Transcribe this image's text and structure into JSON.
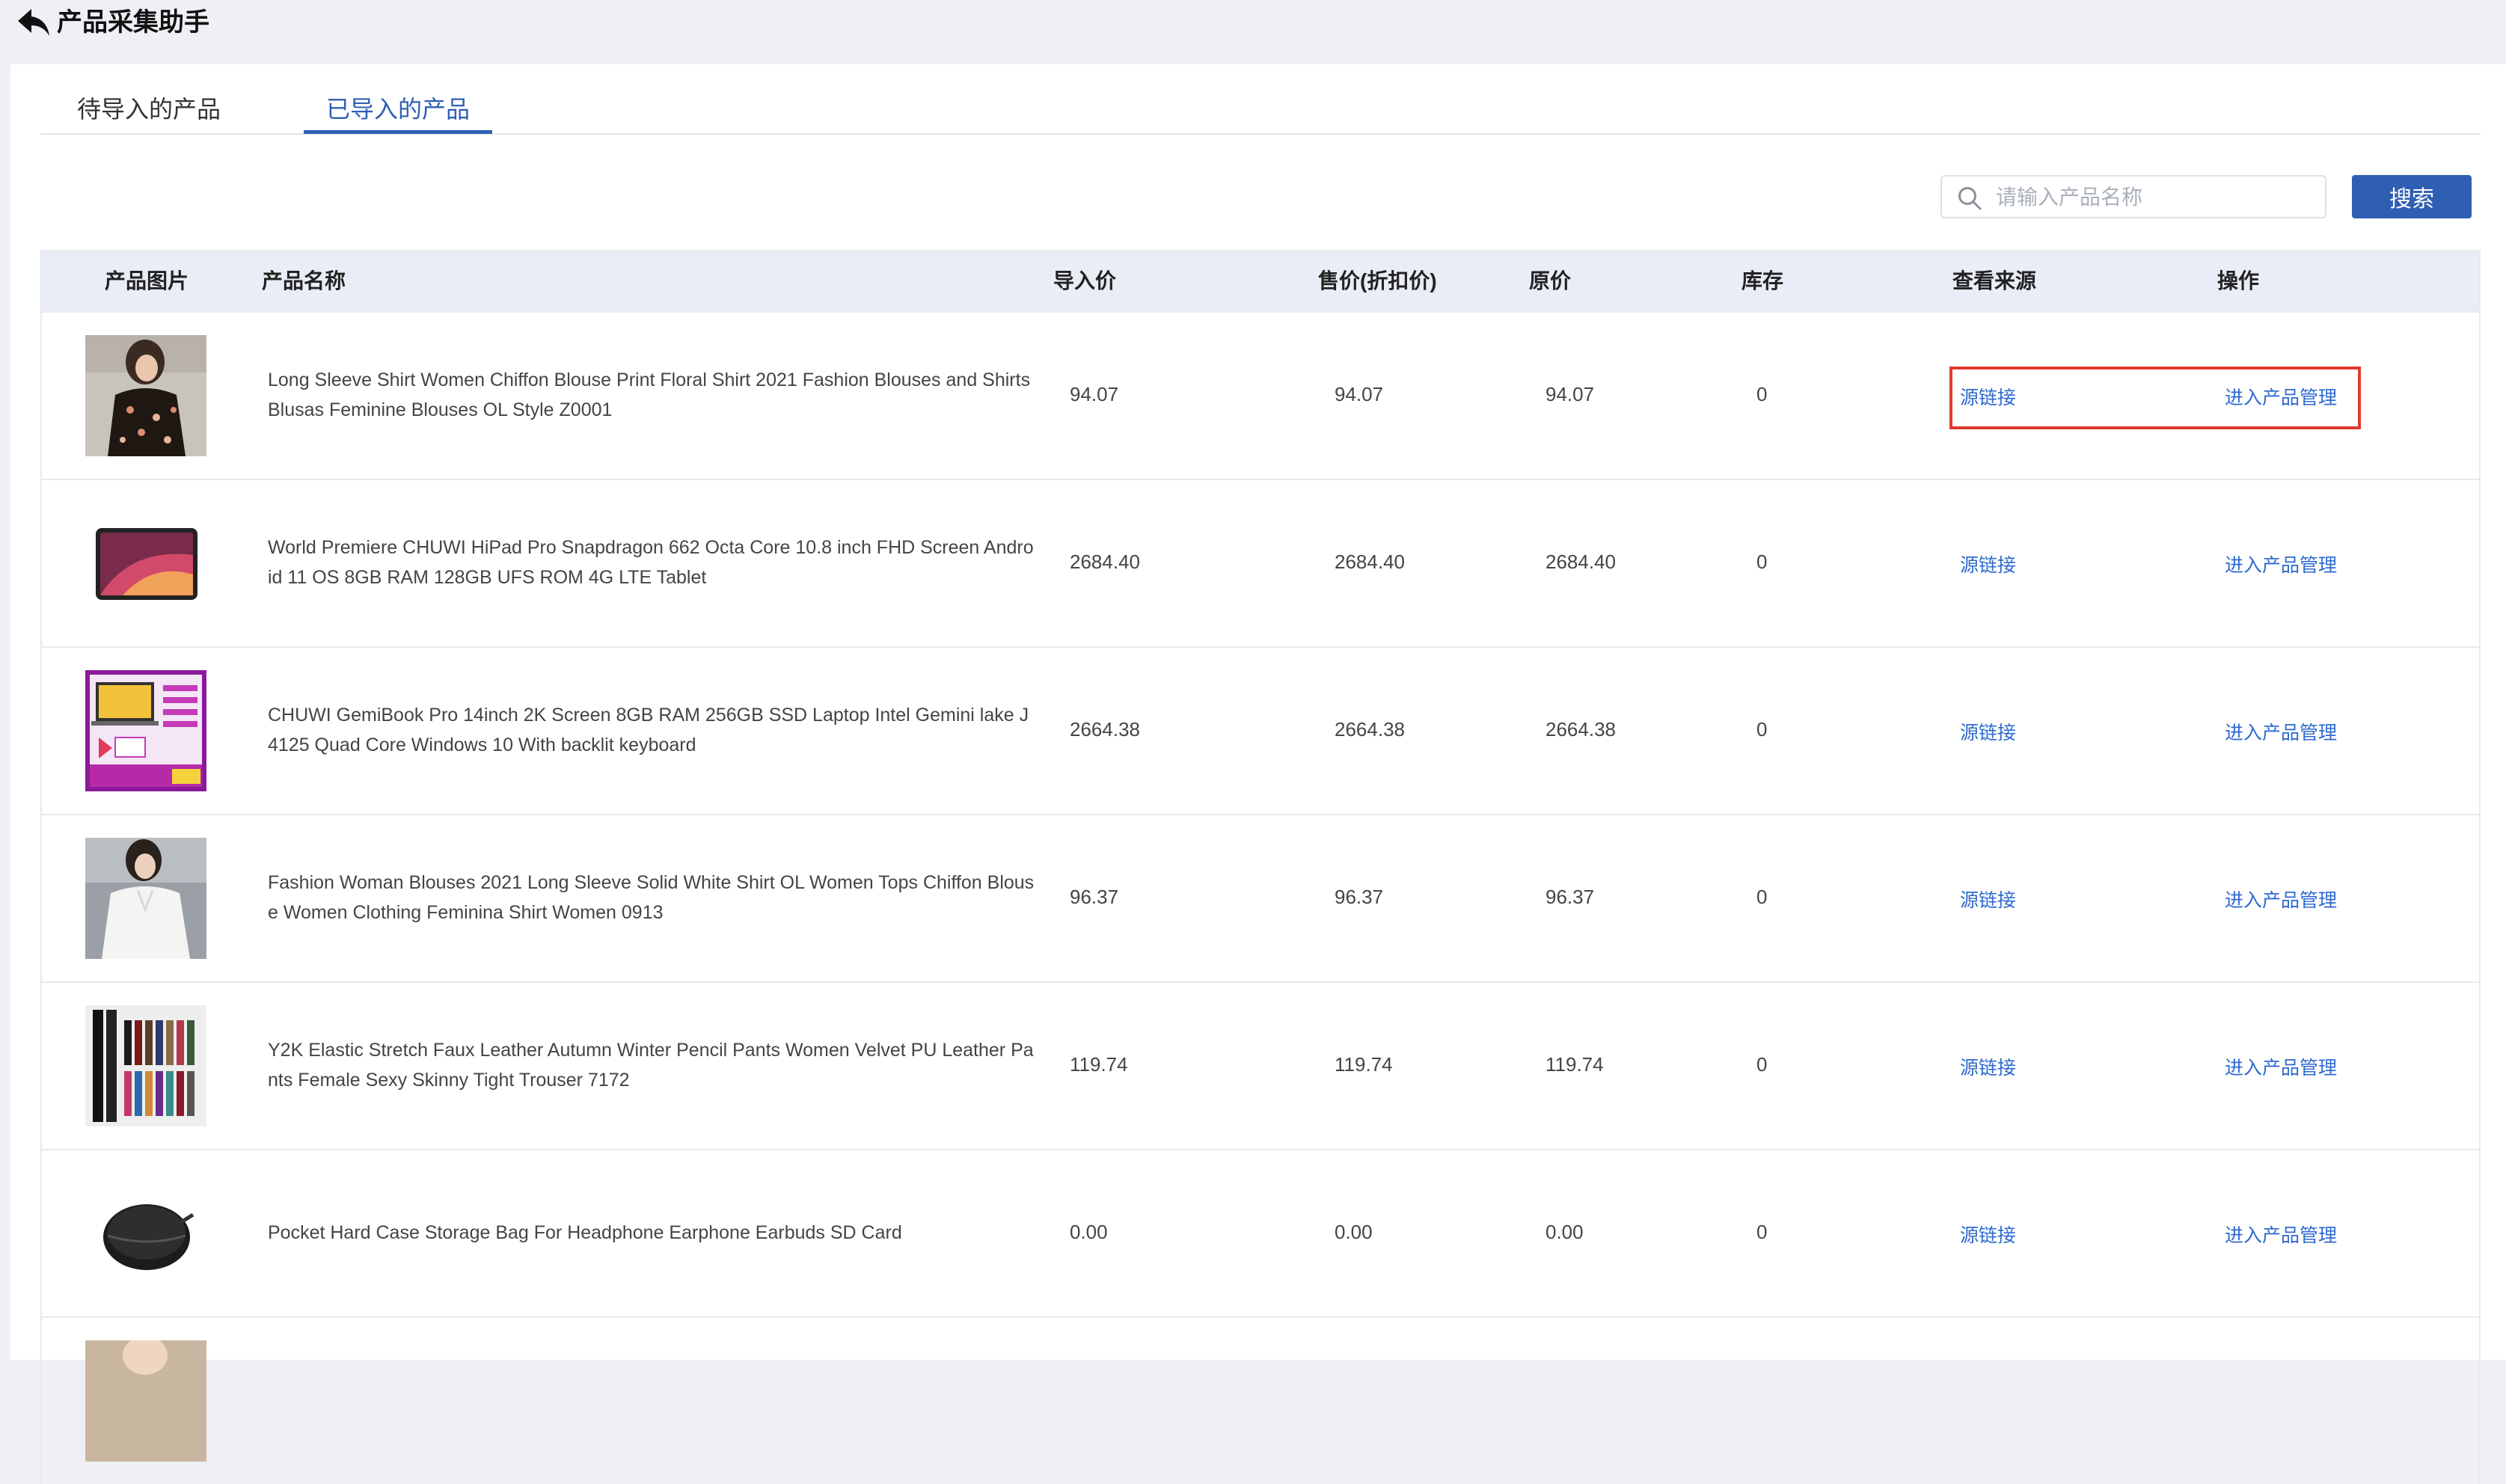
{
  "header": {
    "title": "产品采集助手"
  },
  "tabs": [
    {
      "label": "待导入的产品",
      "active": false
    },
    {
      "label": "已导入的产品",
      "active": true
    }
  ],
  "search": {
    "placeholder": "请输入产品名称",
    "value": "",
    "button_label": "搜索"
  },
  "colors": {
    "accent": "#2f5fb3",
    "link": "#2f6ad0",
    "highlight": "#e03a2f"
  },
  "table": {
    "headers": {
      "image": "产品图片",
      "name": "产品名称",
      "import_price": "导入价",
      "sale_price": "售价(折扣价)",
      "original_price": "原价",
      "stock": "库存",
      "source": "查看来源",
      "action": "操作"
    },
    "rows": [
      {
        "image_icon": "floral-blouse-photo",
        "name": "Long Sleeve Shirt Women Chiffon Blouse Print Floral Shirt 2021 Fashion Blouses and Shirts Blusas Feminine Blouses OL Style Z0001",
        "import_price": "94.07",
        "sale_price": "94.07",
        "original_price": "94.07",
        "stock": "0",
        "source_link": "源链接",
        "action_link": "进入产品管理"
      },
      {
        "image_icon": "tablet-photo",
        "name": "World Premiere CHUWI HiPad Pro Snapdragon 662 Octa Core 10.8 inch FHD Screen Android 11 OS 8GB RAM 128GB UFS ROM 4G LTE Tablet",
        "import_price": "2684.40",
        "sale_price": "2684.40",
        "original_price": "2684.40",
        "stock": "0",
        "source_link": "源链接",
        "action_link": "进入产品管理"
      },
      {
        "image_icon": "laptop-promo-photo",
        "name": "CHUWI GemiBook Pro 14inch 2K Screen 8GB RAM 256GB SSD Laptop Intel Gemini lake J4125 Quad Core Windows 10 With backlit keyboard",
        "import_price": "2664.38",
        "sale_price": "2664.38",
        "original_price": "2664.38",
        "stock": "0",
        "source_link": "源链接",
        "action_link": "进入产品管理"
      },
      {
        "image_icon": "white-blouse-photo",
        "name": "Fashion Woman Blouses 2021 Long Sleeve Solid White Shirt OL Women Tops Chiffon Blouse Women Clothing Feminina Shirt Women 0913",
        "import_price": "96.37",
        "sale_price": "96.37",
        "original_price": "96.37",
        "stock": "0",
        "source_link": "源链接",
        "action_link": "进入产品管理"
      },
      {
        "image_icon": "leather-pants-photo",
        "name": "Y2K Elastic Stretch Faux Leather Autumn Winter Pencil Pants Women Velvet PU Leather Pants Female Sexy Skinny Tight Trouser 7172",
        "import_price": "119.74",
        "sale_price": "119.74",
        "original_price": "119.74",
        "stock": "0",
        "source_link": "源链接",
        "action_link": "进入产品管理"
      },
      {
        "image_icon": "earphone-case-photo",
        "name": "Pocket Hard Case Storage Bag For Headphone Earphone Earbuds SD Card",
        "import_price": "0.00",
        "sale_price": "0.00",
        "original_price": "0.00",
        "stock": "0",
        "source_link": "源链接",
        "action_link": "进入产品管理"
      }
    ]
  }
}
